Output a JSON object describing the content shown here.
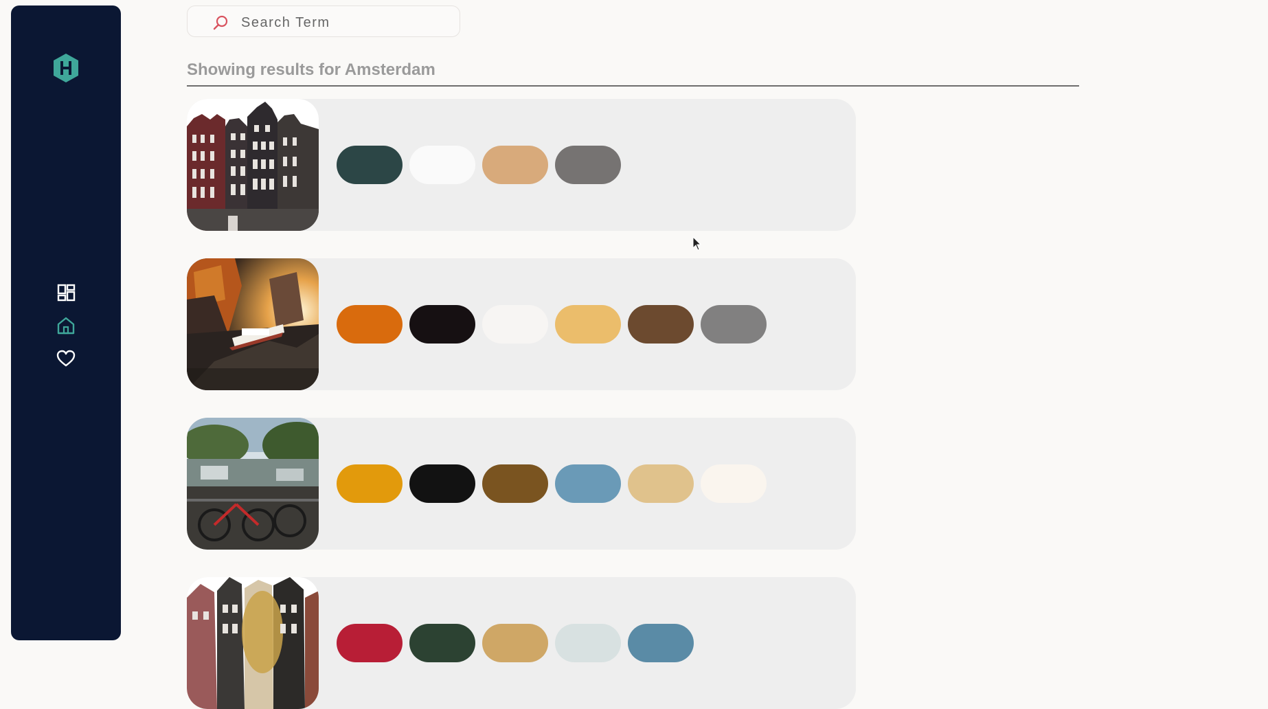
{
  "search": {
    "placeholder": "Search Term",
    "value": ""
  },
  "heading": "Showing results for Amsterdam",
  "sidebar": {
    "logo_letter": "H",
    "logo_color": "#3fa79a",
    "icons": [
      "dashboard-icon",
      "home-icon",
      "heart-icon"
    ]
  },
  "results": [
    {
      "photo": "amsterdam-canal-houses-facade",
      "palette": [
        "#2c4646",
        "#fafafa",
        "#d8aa7b",
        "#767372"
      ]
    },
    {
      "photo": "amsterdam-canal-boat-sunset",
      "palette": [
        "#d96b0d",
        "#161012",
        "#f7f5f3",
        "#ebbd6b",
        "#6c4a2f",
        "#818080"
      ]
    },
    {
      "photo": "amsterdam-canal-bicycles",
      "palette": [
        "#e29a0c",
        "#121212",
        "#7a5420",
        "#6a9ab7",
        "#e0c28c",
        "#faf5ee"
      ]
    },
    {
      "photo": "amsterdam-houses-tree",
      "palette": [
        "#b81e36",
        "#2c4232",
        "#cfa766",
        "#d8e1e1",
        "#5a8ba6"
      ]
    }
  ]
}
